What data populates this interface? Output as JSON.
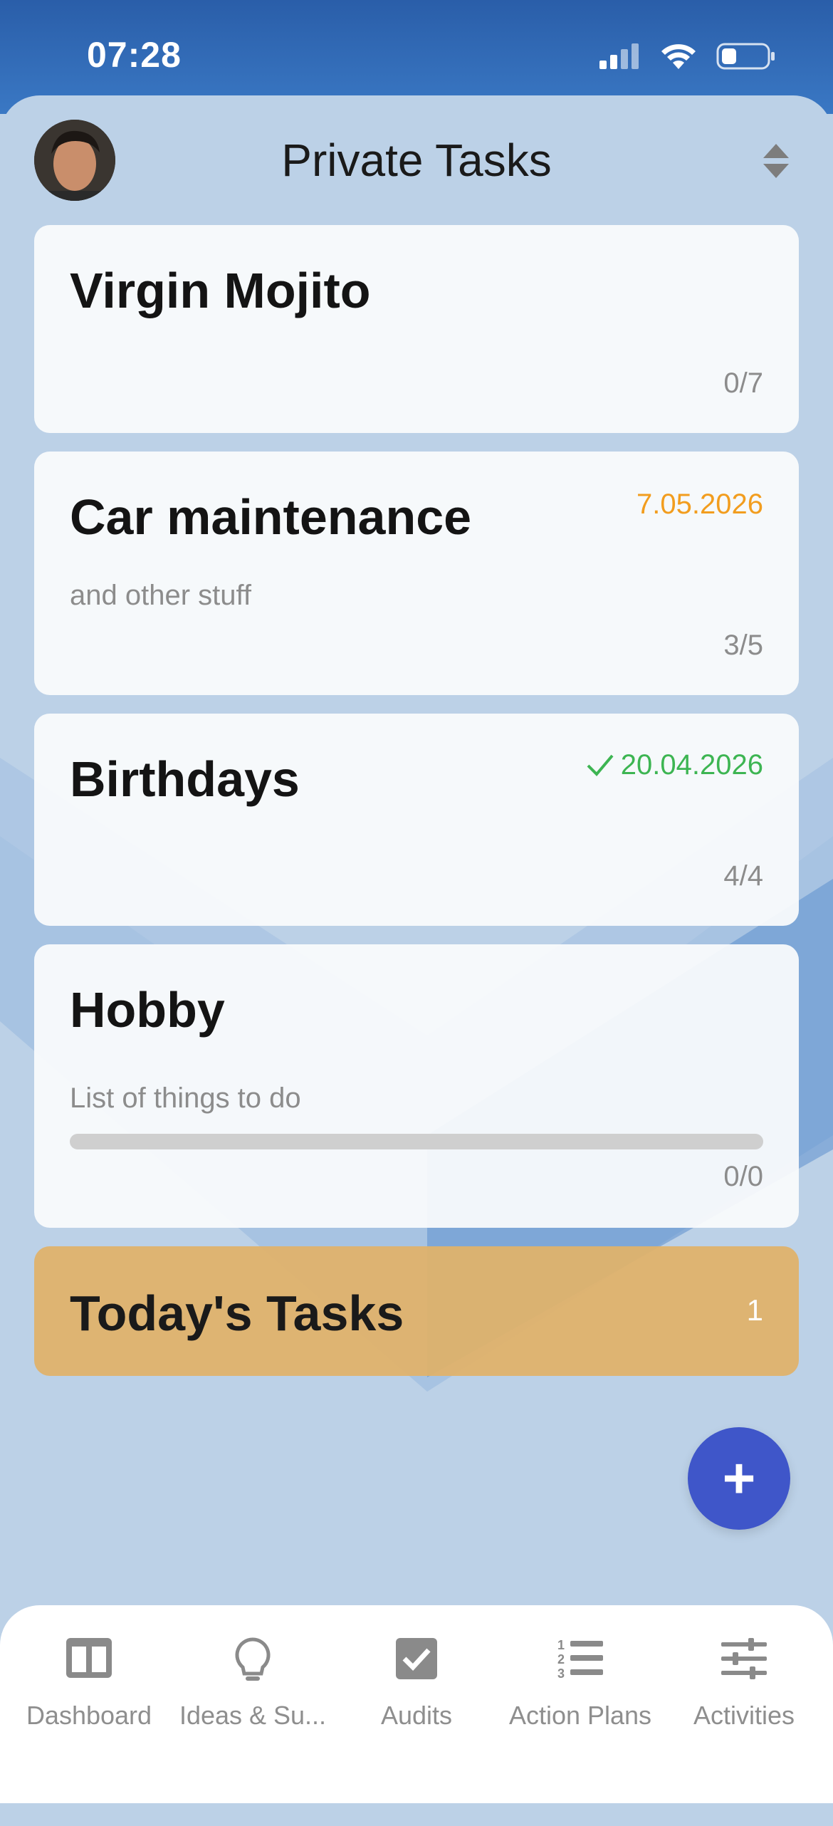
{
  "status_bar": {
    "time": "07:28",
    "signal_icon": "signal-icon",
    "wifi_icon": "wifi-icon",
    "battery_icon": "battery-icon"
  },
  "header": {
    "title": "Private Tasks",
    "avatar_icon": "avatar",
    "sort_icon": "sort-icon"
  },
  "cards": [
    {
      "title": "Virgin Mojito",
      "subtitle": "",
      "date": "",
      "count": "0/7"
    },
    {
      "title": "Car maintenance",
      "subtitle": "and other stuff",
      "date": "7.05.2026",
      "date_color": "#f29d1e",
      "count": "3/5"
    },
    {
      "title": "Birthdays",
      "subtitle": "",
      "date": "20.04.2026",
      "date_color": "#3db552",
      "date_icon": "check-icon",
      "count": "4/4"
    },
    {
      "title": "Hobby",
      "subtitle": "List of things to do",
      "date": "",
      "count": "0/0",
      "progress": 0
    }
  ],
  "today": {
    "title": "Today's Tasks",
    "count": "1"
  },
  "fab": {
    "label": "+",
    "icon": "plus-icon",
    "color": "#3f56c9"
  },
  "tabs": [
    {
      "label": "Dashboard",
      "icon": "dashboard-icon"
    },
    {
      "label": "Ideas & Su...",
      "icon": "lightbulb-icon"
    },
    {
      "label": "Audits",
      "icon": "checkbox-icon"
    },
    {
      "label": "Action Plans",
      "icon": "numbered-list-icon"
    },
    {
      "label": "Activities",
      "icon": "sliders-icon"
    }
  ]
}
